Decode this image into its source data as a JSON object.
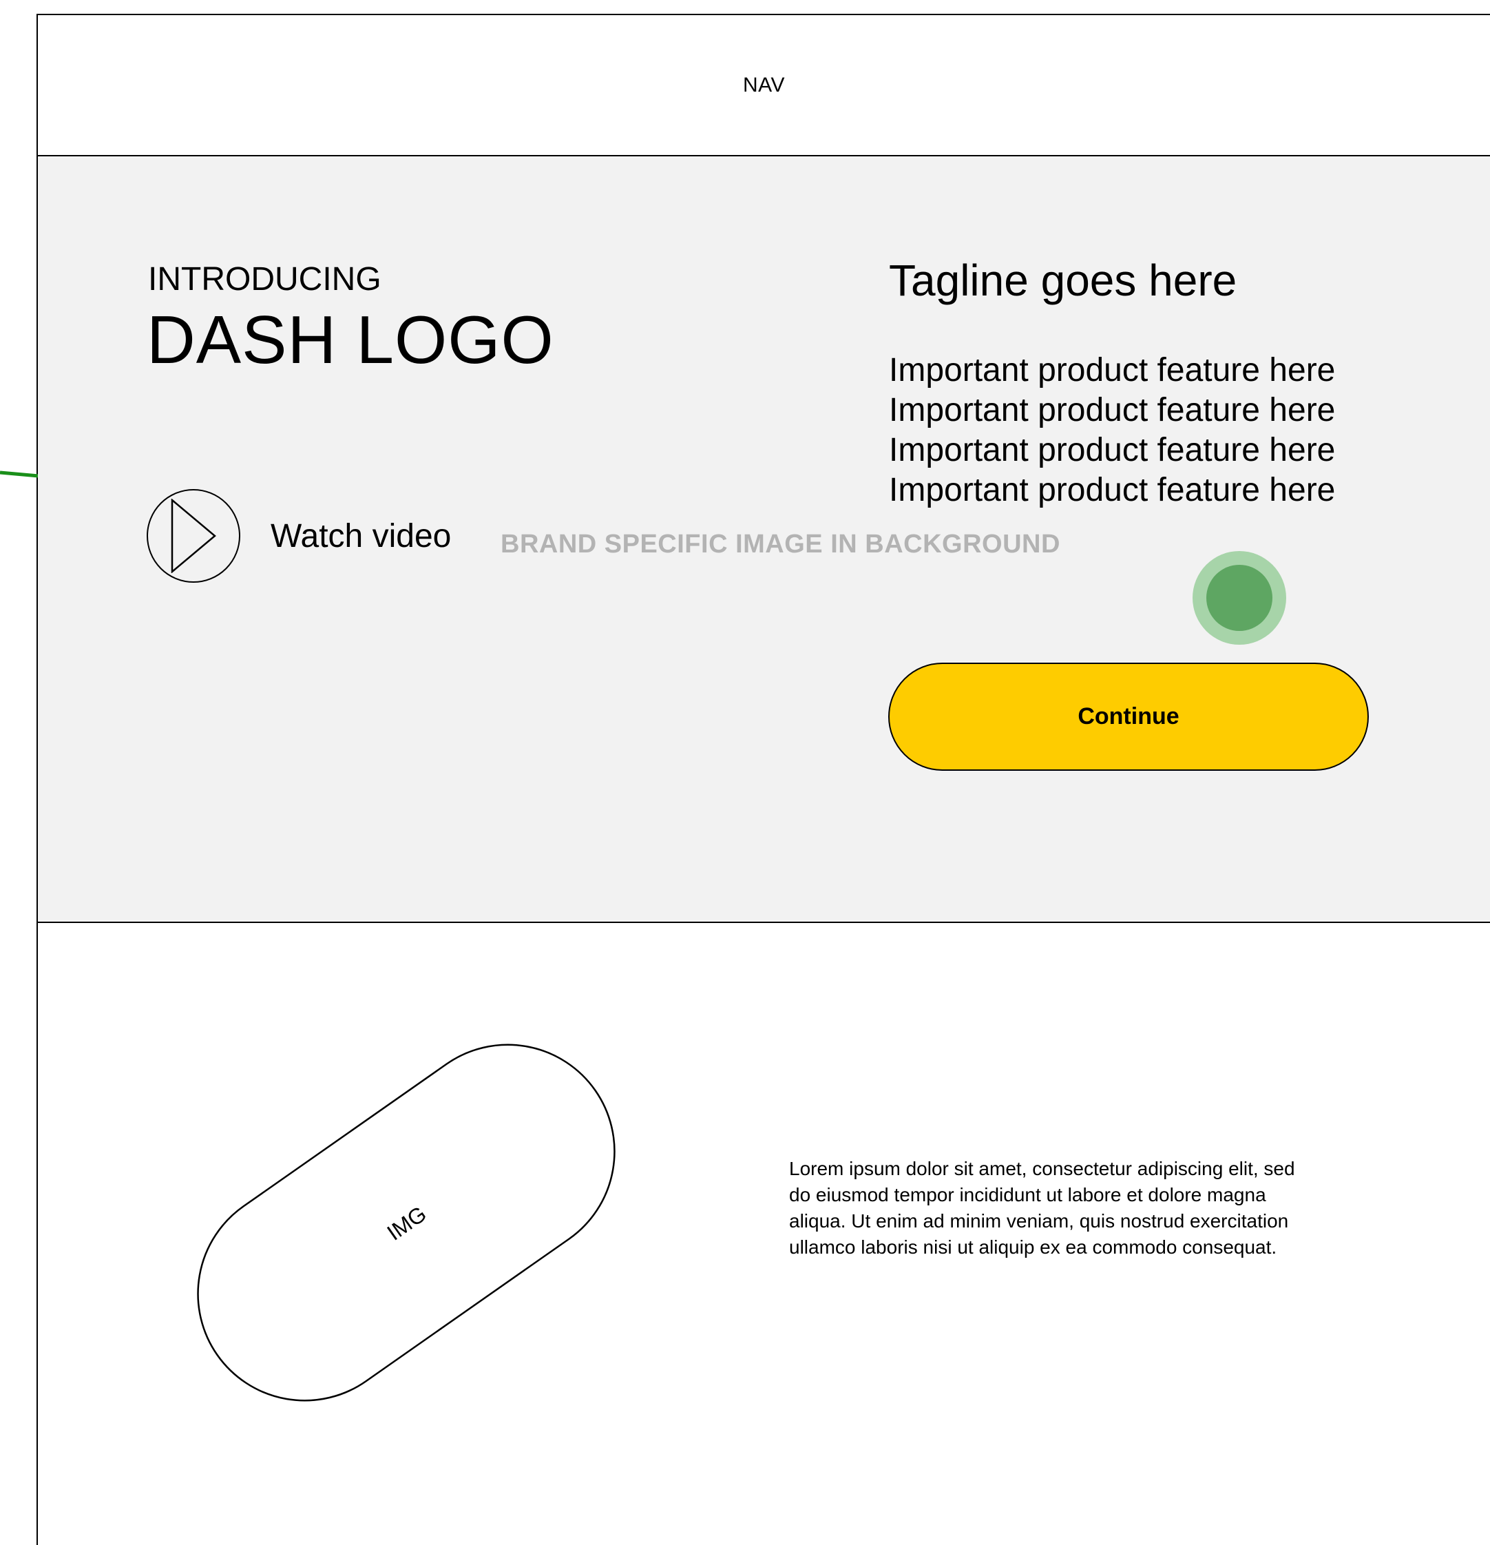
{
  "nav": {
    "label": "NAV"
  },
  "hero": {
    "intro": "INTRODUCING",
    "logo": "DASH LOGO",
    "watch_video": "Watch video",
    "background_note": "BRAND SPECIFIC IMAGE IN BACKGROUND",
    "tagline": "Tagline goes here",
    "features": [
      "Important product feature here",
      "Important product feature here",
      "Important product feature here",
      "Important product feature here"
    ],
    "cta": {
      "label": "Continue",
      "color": "#fecc00"
    }
  },
  "content": {
    "image_label": "IMG",
    "paragraph": "Lorem ipsum dolor sit amet, consectetur adipiscing elit, sed do eiusmod tempor incididunt ut labore et dolore magna aliqua. Ut enim ad minim veniam, quis nostrud exercitation ullamco laboris nisi ut aliquip ex ea commodo consequat."
  },
  "overlay": {
    "click_indicator_color": "#4caf50"
  }
}
